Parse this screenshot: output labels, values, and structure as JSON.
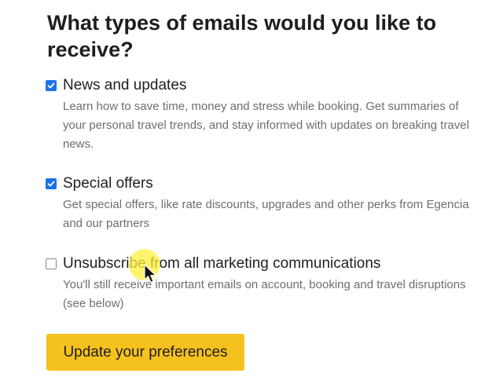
{
  "heading": "What types of emails would you like to receive?",
  "options": [
    {
      "label": "News and updates",
      "checked": true,
      "description": "Learn how to save time, money and stress while booking. Get summaries of your personal travel trends, and stay informed with updates on breaking travel news."
    },
    {
      "label": "Special offers",
      "checked": true,
      "description": "Get special offers, like rate discounts, upgrades and other perks from Egencia and our partners"
    },
    {
      "label": "Unsubscribe from all marketing communications",
      "checked": false,
      "description": "You'll still receive important emails on account, booking and travel disruptions (see below)"
    }
  ],
  "update_button_label": "Update your preferences",
  "colors": {
    "checkbox_checked": "#1a73e8",
    "button": "#f5c11e",
    "cursor_highlight": "#fff03c"
  },
  "icons": {
    "checkmark": "check-icon",
    "cursor": "mouse-pointer-icon"
  }
}
